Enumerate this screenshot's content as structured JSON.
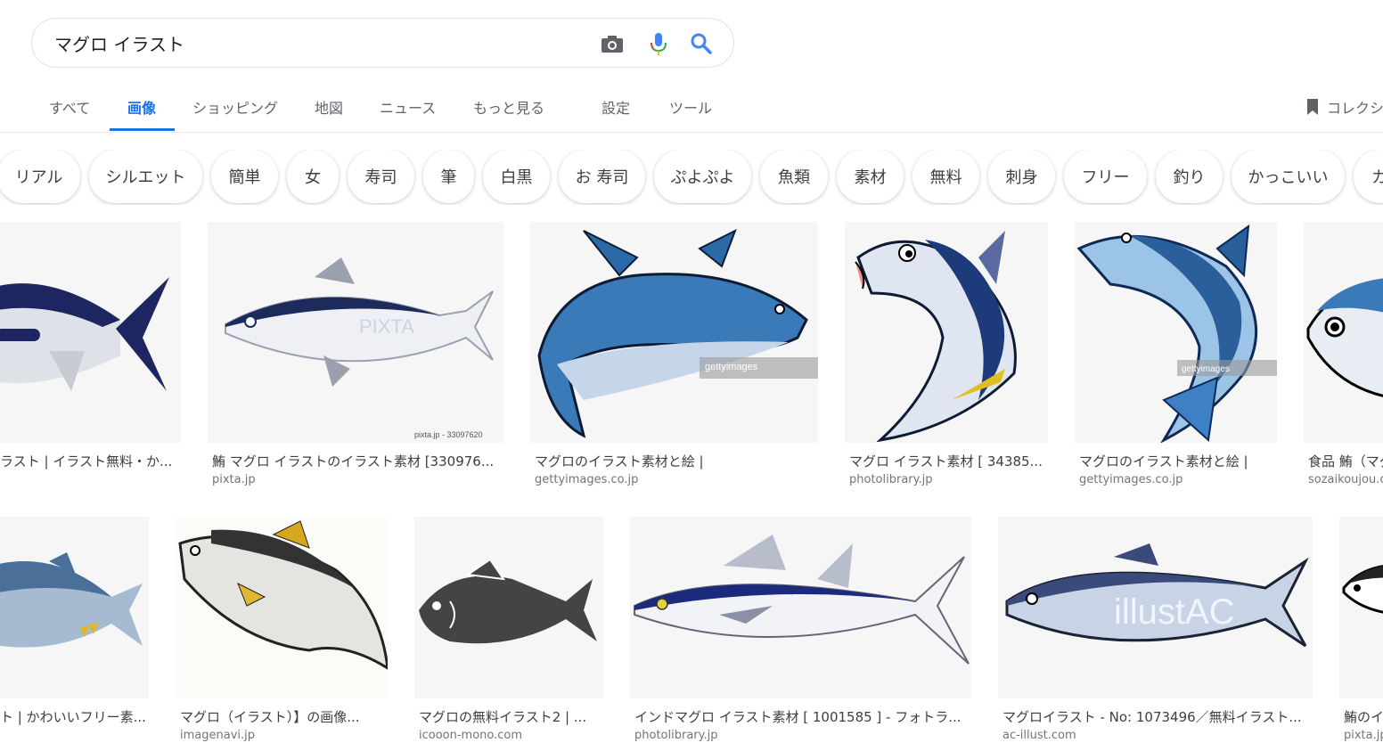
{
  "search": {
    "query": "マグロ イラスト"
  },
  "tabs": [
    {
      "label": "すべて"
    },
    {
      "label": "画像"
    },
    {
      "label": "ショッピング"
    },
    {
      "label": "地図"
    },
    {
      "label": "ニュース"
    },
    {
      "label": "もっと見る"
    },
    {
      "label": "設定"
    },
    {
      "label": "ツール"
    }
  ],
  "collections_label": "コレクション",
  "chips": [
    "リアル",
    "シルエット",
    "簡単",
    "女",
    "寿司",
    "筆",
    "白黒",
    "お 寿司",
    "ぷよぷよ",
    "魚類",
    "素材",
    "無料",
    "刺身",
    "フリー",
    "釣り",
    "かっこいい",
    "カ"
  ],
  "results_row1": [
    {
      "caption": "ラスト | イラスト無料・か...",
      "source": ""
    },
    {
      "caption": "鮪 マグロ イラストのイラスト素材 [330976...",
      "source": "pixta.jp"
    },
    {
      "caption": "マグロのイラスト素材と絵 |",
      "source": "gettyimages.co.jp"
    },
    {
      "caption": "マグロ イラスト素材 [ 34385...",
      "source": "photolibrary.jp"
    },
    {
      "caption": "マグロのイラスト素材と絵 |",
      "source": "gettyimages.co.jp"
    },
    {
      "caption": "食品 鮪（マグ",
      "source": "sozaikoujou.c"
    }
  ],
  "results_row2": [
    {
      "caption": "ト | かわいいフリー素...",
      "source": ""
    },
    {
      "caption": "マグロ（イラスト）】の画像...",
      "source": "imagenavi.jp"
    },
    {
      "caption": "マグロの無料イラスト2 | ...",
      "source": "icooon-mono.com"
    },
    {
      "caption": "インドマグロ イラスト素材 [ 1001585 ] - フォトラ...",
      "source": "photolibrary.jp"
    },
    {
      "caption": "マグロイラスト - No: 1073496／無料イラスト...",
      "source": "ac-illust.com"
    },
    {
      "caption": "鮪のイ",
      "source": "pixta.jp"
    }
  ],
  "watermarks": {
    "pixta_id": "pixta.jp - 33097620",
    "getty": "gettyimages",
    "pixta": "PIXTA",
    "illustac": "illustAC"
  },
  "colors": {
    "accent": "#1a73e8",
    "tuna_navy": "#1d2a5c",
    "tuna_blue": "#3a7ab8"
  }
}
